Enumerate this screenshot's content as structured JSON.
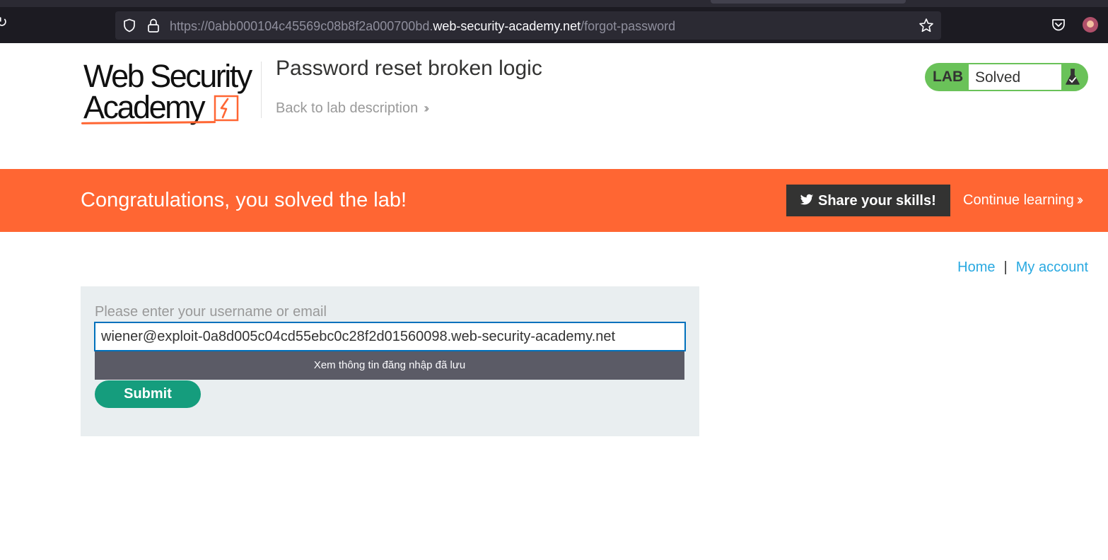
{
  "browser": {
    "url_prefix": "https://0abb000104c45569c08b8f2a000700bd.",
    "url_host": "web-security-academy.net",
    "url_path": "/forgot-password"
  },
  "header": {
    "logo_line1": "Web Security",
    "logo_line2": "Academy",
    "title": "Password reset broken logic",
    "back_link": "Back to lab description"
  },
  "lab_badge": {
    "label": "LAB",
    "status": "Solved"
  },
  "banner": {
    "message": "Congratulations, you solved the lab!",
    "share_label": "Share your skills!",
    "continue_label": "Continue learning",
    "color": "#ff6633"
  },
  "nav": {
    "home": "Home",
    "separator": "|",
    "my_account": "My account"
  },
  "form": {
    "label": "Please enter your username or email",
    "value": "wiener@exploit-0a8d005c04cd55ebc0c28f2d01560098.web-security-academy.net",
    "autofill_hint": "Xem thông tin đăng nhập đã lưu",
    "submit_label": "Submit"
  }
}
